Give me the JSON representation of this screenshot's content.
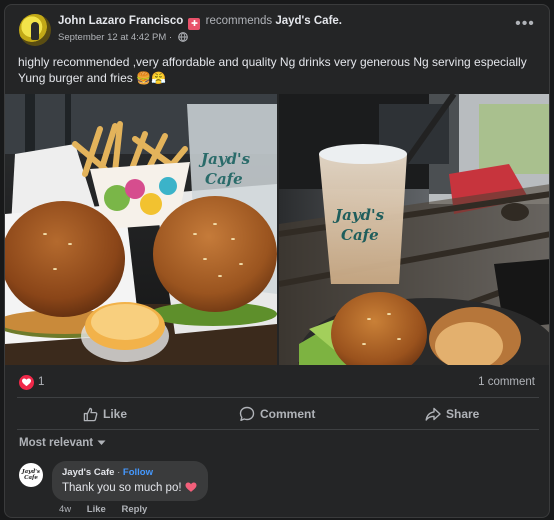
{
  "post": {
    "author": "John Lazaro Francisco",
    "recommends_text": "recommends",
    "page_name": "Jayd's Cafe.",
    "timestamp": "September 12 at 4:42 PM",
    "separator": "·",
    "privacy_icon": "globe-icon",
    "more_icon": "more-options-icon",
    "more_label": "•••",
    "text": "highly recommended ,very affordable and quality Ng drinks very generous Ng serving especially Yung burger and fries 🍔😤",
    "photo_cup_text_left": "Jayd's Cafe",
    "photo_cup_text_right": "Jayd's Cafe"
  },
  "stats": {
    "reaction_icon": "heart-icon",
    "reaction_count": "1",
    "comment_count": "1 comment"
  },
  "actions": {
    "like_label": "Like",
    "comment_label": "Comment",
    "share_label": "Share"
  },
  "comments_section": {
    "sort_label": "Most relevant"
  },
  "comment": {
    "avatar_text": "Jayd's Cafe",
    "author": "Jayd's Cafe",
    "dot": "·",
    "follow_label": "Follow",
    "text": "Thank you so much po!",
    "time": "4w",
    "like_label": "Like",
    "reply_label": "Reply"
  },
  "colors": {
    "background": "#18191a",
    "card": "#242526",
    "text_primary": "#e4e6eb",
    "text_secondary": "#b0b3b8",
    "follow_blue": "#4599ff",
    "heart_red": "#f02849"
  }
}
